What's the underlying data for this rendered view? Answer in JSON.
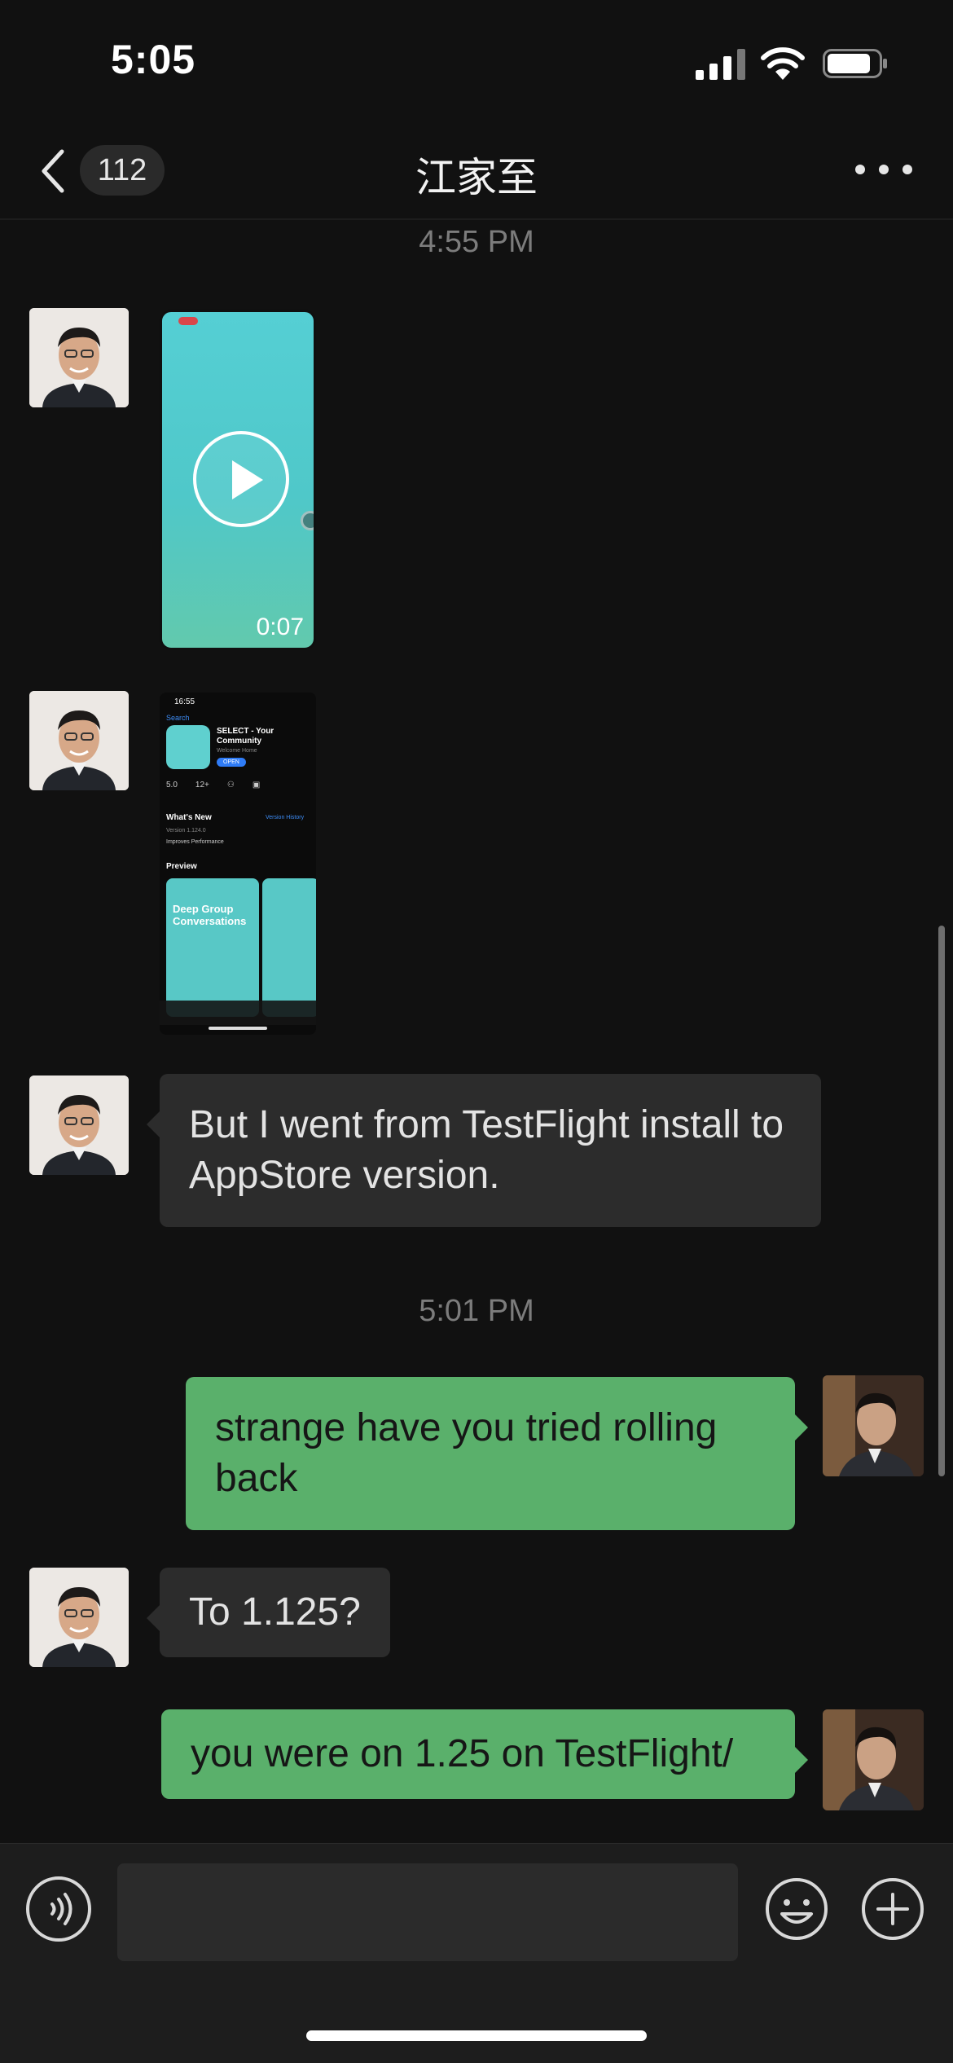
{
  "status_bar": {
    "time": "5:05"
  },
  "nav": {
    "unread_count": "112",
    "title": "江家至"
  },
  "chat": {
    "timestamps": [
      "4:55 PM",
      "5:01 PM"
    ],
    "video": {
      "duration": "0:07"
    },
    "appstore_screenshot": {
      "time": "16:55",
      "back": "Search",
      "app_name": "SELECT - Your Community",
      "subtitle": "Welcome Home",
      "open": "OPEN",
      "stats": [
        "5.0",
        "12+",
        "⚇",
        "▣"
      ],
      "whats_new": "What's New",
      "version_history": "Version History",
      "version": "Version 1.124.0",
      "improves": "Improves Performance",
      "preview": "Preview",
      "card_text": "Deep Group Conversations"
    },
    "messages": [
      {
        "sender": "in",
        "text": "But I went from TestFlight install to AppStore version."
      },
      {
        "sender": "out",
        "text": "strange have you tried rolling back"
      },
      {
        "sender": "in",
        "text": "To 1.125?"
      },
      {
        "sender": "out",
        "text": "you were on 1.25 on TestFlight/"
      }
    ]
  },
  "input": {
    "value": ""
  }
}
